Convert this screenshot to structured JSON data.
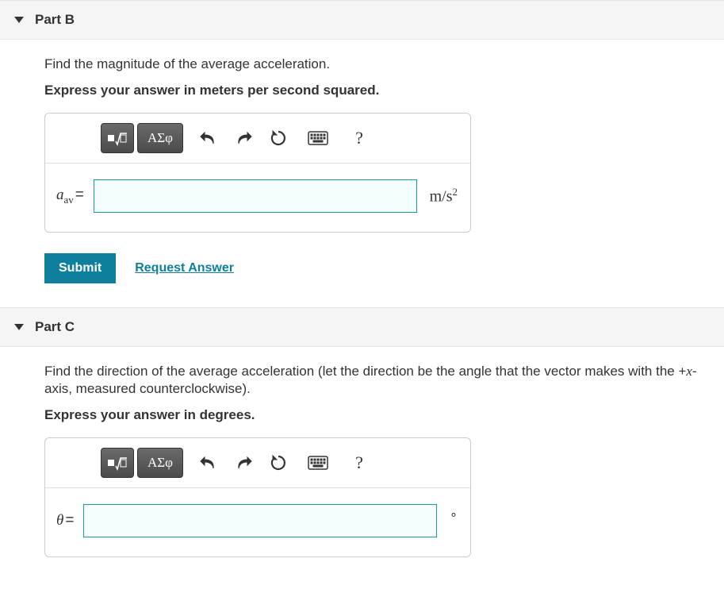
{
  "partB": {
    "title": "Part B",
    "prompt": "Find the magnitude of the average acceleration.",
    "instruction": "Express your answer in meters per second squared.",
    "toolbar": {
      "templates_label": "templates",
      "symbols_label": "ΑΣφ",
      "undo": "undo",
      "redo": "redo",
      "reset": "reset",
      "keyboard": "keyboard",
      "help": "?"
    },
    "variable_html": "a<sub>av</sub>",
    "equals": "=",
    "input_value": "",
    "unit_html": "m/s<sup>2</sup>",
    "submit": "Submit",
    "request_answer": "Request Answer"
  },
  "partC": {
    "title": "Part C",
    "prompt_prefix": "Find the direction of the average acceleration (let the direction be the angle that the vector makes with the +",
    "prompt_var": "x",
    "prompt_suffix": "-axis, measured counterclockwise).",
    "instruction": "Express your answer in degrees.",
    "toolbar": {
      "templates_label": "templates",
      "symbols_label": "ΑΣφ",
      "undo": "undo",
      "redo": "redo",
      "reset": "reset",
      "keyboard": "keyboard",
      "help": "?"
    },
    "variable": "θ",
    "equals": "=",
    "input_value": "",
    "unit": "∘"
  }
}
